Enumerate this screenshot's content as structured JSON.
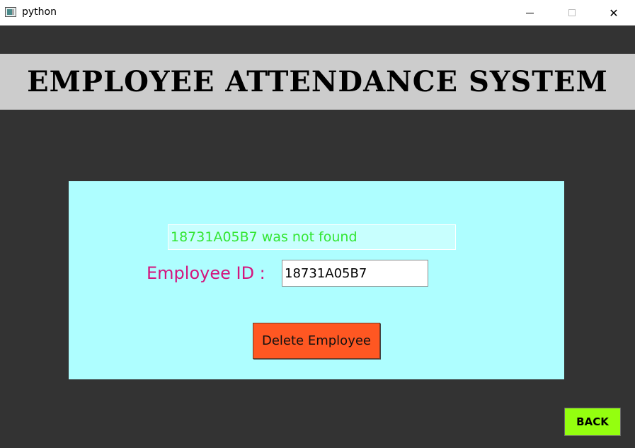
{
  "window": {
    "title": "python",
    "icons": [
      "app-icon",
      "minimize-icon",
      "maximize-icon",
      "close-icon"
    ],
    "close_glyph": "✕"
  },
  "header": {
    "title": "EMPLOYEE ATTENDANCE SYSTEM"
  },
  "form": {
    "status_message": "18731A05B7 was not found",
    "employee_id_label": "Employee ID :",
    "employee_id_value": "18731A05B7",
    "delete_button_label": "Delete Employee"
  },
  "nav": {
    "back_button_label": "BACK"
  },
  "colors": {
    "background": "#333333",
    "header_band": "#cccccc",
    "panel": "#aefeff",
    "status_text": "#33e633",
    "label_text": "#d4157d",
    "delete_button": "#ff5722",
    "back_button": "#94ff0f"
  }
}
